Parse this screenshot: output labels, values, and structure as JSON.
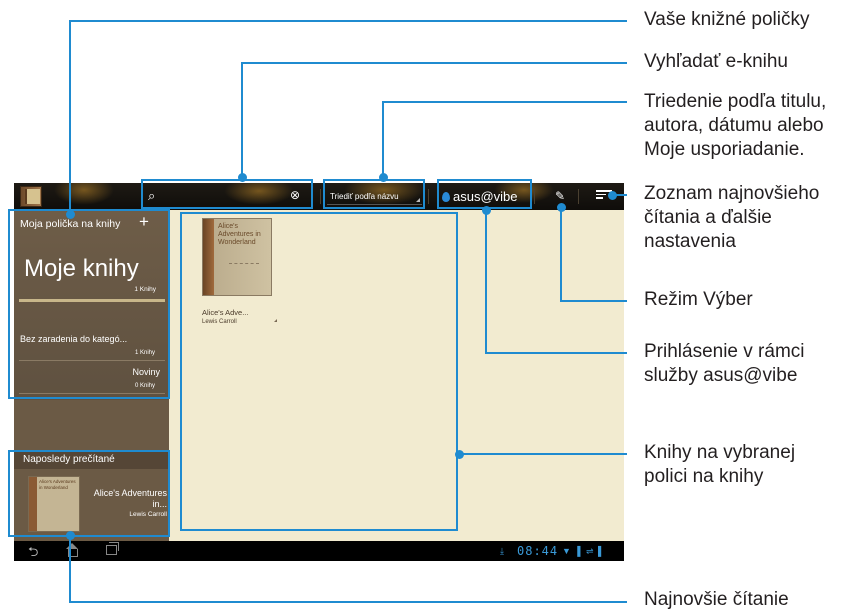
{
  "screen": {
    "search": {
      "placeholder": ""
    },
    "sort_label": "Triediť podľa názvu",
    "vibe_label": "asus@vibe",
    "sidebar": {
      "header": "Moja polička na knihy",
      "add_symbol": "+",
      "main_shelf": {
        "name": "Moje knihy",
        "count": "1 Knihy"
      },
      "categories": [
        {
          "name": "Bez zaradenia do kategó...",
          "count": "1 Knihy"
        },
        {
          "name": "Noviny",
          "count": "0 Knihy"
        }
      ],
      "recent": {
        "header": "Naposledy prečítané",
        "title": "Alice's Adventures in...",
        "author": "Lewis Carroll",
        "cover_text": "Alice's Adventures in Wonderland"
      }
    },
    "book": {
      "cover_text": "Alice's Adventures in Wonderland",
      "title": "Alice's Adve...",
      "author": "Lewis Carroll"
    },
    "status": {
      "time": "08:44"
    }
  },
  "callouts": {
    "bookshelves": "Vaše knižné poličky",
    "search": "Vyhľadať e-knihu",
    "sort": [
      "Triedenie podľa titulu,",
      "autora, dátumu alebo",
      "Moje usporiadanie."
    ],
    "recent_list": [
      "Zoznam najnovšieho",
      "čítania a ďalšie",
      "nastavenia"
    ],
    "select_mode": "Režim Výber",
    "vibe_login": [
      "Prihlásenie v rámci",
      "služby asus@vibe"
    ],
    "books_on_shelf": [
      "Knihy na vybranej",
      "polici na knihy"
    ],
    "latest_reading": "Najnovšie čítanie"
  },
  "colors": {
    "callout": "#1f8bd0",
    "screen_bg": "#f2ebd0",
    "sidebar": "#6b5a45",
    "topbar": "#1a1611"
  }
}
